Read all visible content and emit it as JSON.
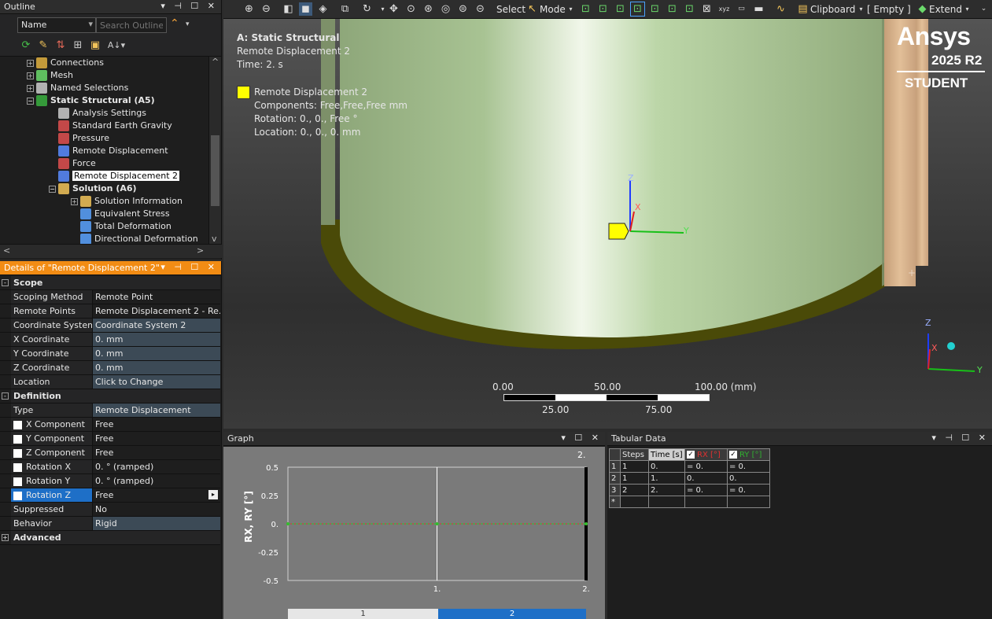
{
  "outline": {
    "title": "Outline",
    "filter_value": "Name",
    "search_placeholder": "Search Outline",
    "tree": [
      {
        "label": "Connections",
        "level": 0,
        "icon": "connections-icon",
        "bold": false
      },
      {
        "label": "Mesh",
        "level": 0,
        "icon": "mesh-icon",
        "bold": false
      },
      {
        "label": "Named Selections",
        "level": 0,
        "icon": "named-selections-icon",
        "bold": false
      },
      {
        "label": "Static Structural (A5)",
        "level": 0,
        "icon": "static-structural-icon",
        "bold": true
      },
      {
        "label": "Analysis Settings",
        "level": 1,
        "icon": "analysis-settings-icon",
        "bold": false
      },
      {
        "label": "Standard Earth Gravity",
        "level": 1,
        "icon": "gravity-icon",
        "bold": false
      },
      {
        "label": "Pressure",
        "level": 1,
        "icon": "pressure-icon",
        "bold": false
      },
      {
        "label": "Remote Displacement",
        "level": 1,
        "icon": "remote-displacement-icon",
        "bold": false
      },
      {
        "label": "Force",
        "level": 1,
        "icon": "force-icon",
        "bold": false
      },
      {
        "label": "Remote Displacement 2",
        "level": 1,
        "icon": "remote-displacement-icon",
        "bold": false,
        "selected": true
      },
      {
        "label": "Solution (A6)",
        "level": 1,
        "icon": "solution-icon",
        "bold": true
      },
      {
        "label": "Solution Information",
        "level": 2,
        "icon": "solution-information-icon",
        "bold": false
      },
      {
        "label": "Equivalent Stress",
        "level": 2,
        "icon": "result-icon",
        "bold": false
      },
      {
        "label": "Total Deformation",
        "level": 2,
        "icon": "result-icon",
        "bold": false
      },
      {
        "label": "Directional Deformation",
        "level": 2,
        "icon": "result-icon",
        "bold": false
      }
    ]
  },
  "details": {
    "title": "Details of \"Remote Displacement 2\"",
    "rows": [
      {
        "type": "section",
        "label": "Scope",
        "mark": "-"
      },
      {
        "k": "Scoping Method",
        "v": "Remote Point"
      },
      {
        "k": "Remote Points",
        "v": "Remote Displacement 2 - Re..."
      },
      {
        "k": "Coordinate System",
        "v": "Coordinate System 2",
        "alt": true
      },
      {
        "k": "X Coordinate",
        "v": "0. mm",
        "alt": true
      },
      {
        "k": "Y Coordinate",
        "v": "0. mm",
        "alt": true
      },
      {
        "k": "Z Coordinate",
        "v": "0. mm",
        "alt": true
      },
      {
        "k": "Location",
        "v": "Click to Change",
        "alt": true
      },
      {
        "type": "section",
        "label": "Definition",
        "mark": "-"
      },
      {
        "k": "Type",
        "v": "Remote Displacement",
        "alt": true
      },
      {
        "k": "X Component",
        "v": "Free",
        "cb": true
      },
      {
        "k": "Y Component",
        "v": "Free",
        "cb": true
      },
      {
        "k": "Z Component",
        "v": "Free",
        "cb": true
      },
      {
        "k": "Rotation X",
        "v": "0. °  (ramped)",
        "cb": true
      },
      {
        "k": "Rotation Y",
        "v": "0. °  (ramped)",
        "cb": true
      },
      {
        "k": "Rotation Z",
        "v": "Free",
        "cb": true,
        "hl": true
      },
      {
        "k": "Suppressed",
        "v": "No"
      },
      {
        "k": "Behavior",
        "v": "Rigid",
        "alt": true
      },
      {
        "type": "section",
        "label": "Advanced",
        "mark": "+"
      }
    ]
  },
  "toolbar": {
    "select": "Select",
    "mode": "Mode",
    "clipboard": "Clipboard",
    "empty": "[ Empty ]",
    "extend": "Extend"
  },
  "viewport": {
    "overlay_title": "A: Static Structural",
    "overlay_sub": "Remote Displacement 2",
    "overlay_time": "Time: 2. s",
    "legend_name": "Remote Displacement 2",
    "legend_components": "Components: Free,Free,Free mm",
    "legend_rotation": "Rotation: 0., 0., Free °",
    "legend_location": "Location: 0., 0., 0. mm",
    "brand": "Ansys",
    "brand_version": "2025 R2",
    "brand_edition": "STUDENT",
    "scale_top": [
      "0.00",
      "50.00",
      "100.00 (mm)"
    ],
    "scale_bottom": [
      "25.00",
      "75.00"
    ],
    "axis_labels": {
      "z": "Z",
      "x": "X",
      "y": "Y"
    },
    "colors": {
      "legend_swatch": "#ffff00",
      "body": "#b5cfa0",
      "edge": "#4a4a08",
      "plate": "#d4b08a"
    }
  },
  "graph": {
    "title": "Graph",
    "ylabel": "RX, RY [°]",
    "corner_label": "2.",
    "step_tabs": [
      "1",
      "2"
    ]
  },
  "chart_data": {
    "type": "line",
    "title": "",
    "xlabel": "",
    "ylabel": "RX, RY [°]",
    "ylim": [
      -0.5,
      0.5
    ],
    "yticks": [
      "0.5",
      "0.25",
      "0.",
      "-0.25",
      "-0.5"
    ],
    "xticks": [
      "1.",
      "2."
    ],
    "x": [
      0,
      1,
      2
    ],
    "series": [
      {
        "name": "RX [°]",
        "values": [
          0,
          0,
          0
        ]
      },
      {
        "name": "RY [°]",
        "values": [
          0,
          0,
          0
        ]
      }
    ]
  },
  "tabular": {
    "title": "Tabular Data",
    "headers": [
      "Steps",
      "Time [s]",
      "RX [°]",
      "RY [°]"
    ],
    "rows": [
      [
        "1",
        "1",
        "0.",
        "= 0.",
        "= 0."
      ],
      [
        "2",
        "1",
        "1.",
        "0.",
        "0."
      ],
      [
        "3",
        "2",
        "2.",
        "= 0.",
        "= 0."
      ],
      [
        "*",
        "",
        "",
        "",
        ""
      ]
    ]
  }
}
